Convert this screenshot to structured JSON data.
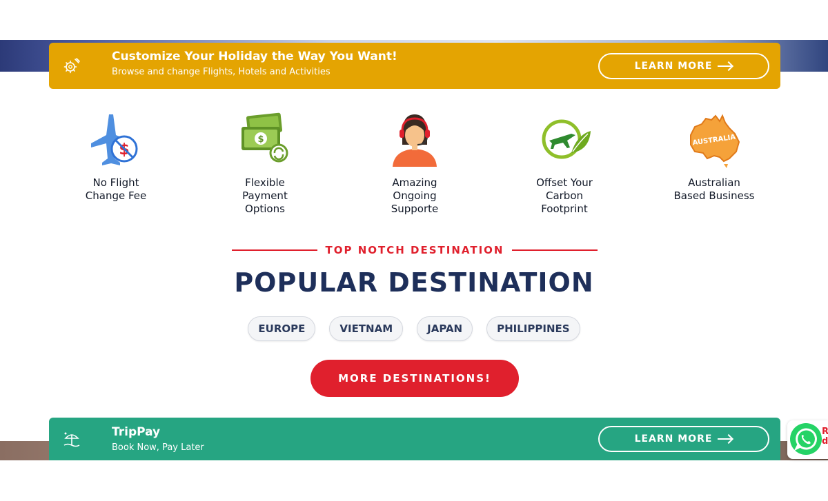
{
  "promo_banner": {
    "title": "Customize Your Holiday the Way You Want!",
    "subtitle": "Browse and change Flights, Hotels and Activities",
    "button_label": "LEARN MORE",
    "color": "#e4a402"
  },
  "features": [
    {
      "line1": "No Flight",
      "line2": "Change Fee",
      "line3": ""
    },
    {
      "line1": "Flexible",
      "line2": "Payment",
      "line3": "Options"
    },
    {
      "line1": "Amazing",
      "line2": "Ongoing",
      "line3": "Supporte"
    },
    {
      "line1": "Offset Your",
      "line2": "Carbon",
      "line3": "Footprint"
    },
    {
      "line1": "Australian",
      "line2": "Based Business",
      "line3": ""
    }
  ],
  "australia_map_text": "AUSTRALIA",
  "destinations": {
    "eyebrow": "TOP NOTCH DESTINATION",
    "title": "POPULAR DESTINATION",
    "chips": [
      "EUROPE",
      "VIETNAM",
      "JAPAN",
      "PHILIPPINES"
    ],
    "more_button": "MORE DESTINATIONS!"
  },
  "trippay_banner": {
    "title": "TripPay",
    "subtitle": "Book Now, Pay Later",
    "button_label": "LEARN MORE",
    "color": "#26a582"
  },
  "whatsapp": {
    "icon": "whatsapp-icon",
    "label_fragment": "R\nd"
  },
  "colors": {
    "accent_red": "#e0202d",
    "title_navy": "#1e2f5a"
  }
}
